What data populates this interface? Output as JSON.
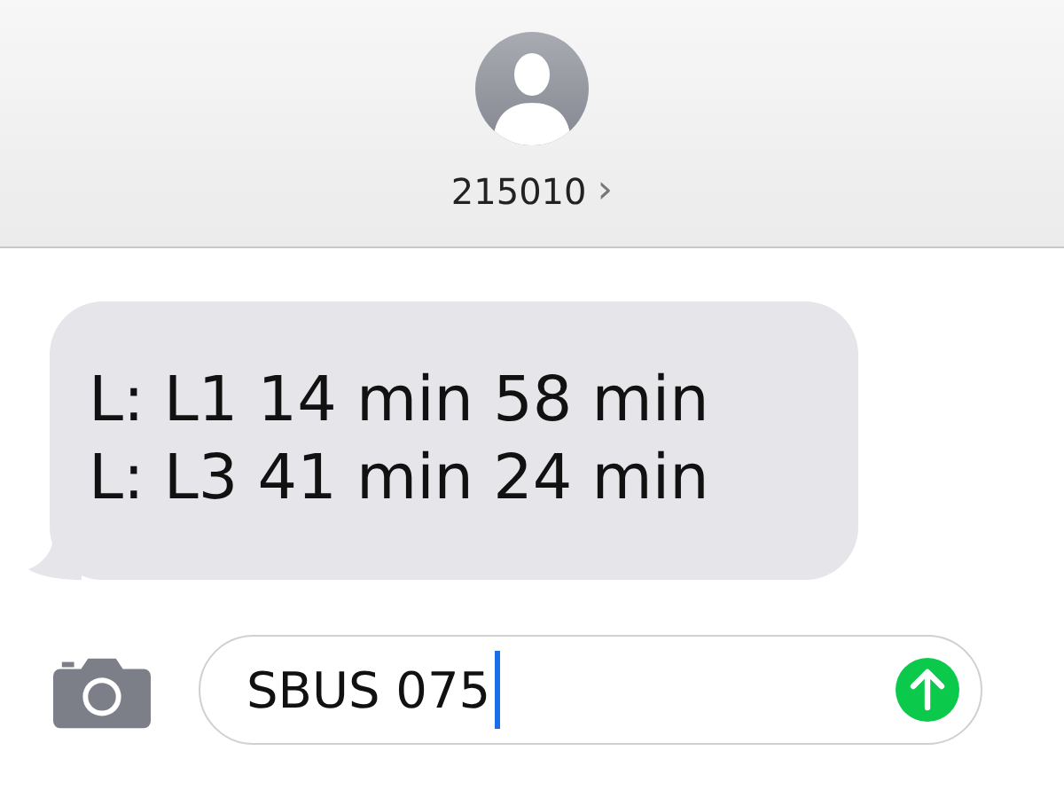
{
  "header": {
    "contact": "215010",
    "chevron": "›"
  },
  "messages": [
    {
      "lines": [
        "L: L1 14 min 58 min",
        "L: L3 41 min 24 min"
      ]
    }
  ],
  "compose": {
    "value": "SBUS 075",
    "focused": true
  }
}
